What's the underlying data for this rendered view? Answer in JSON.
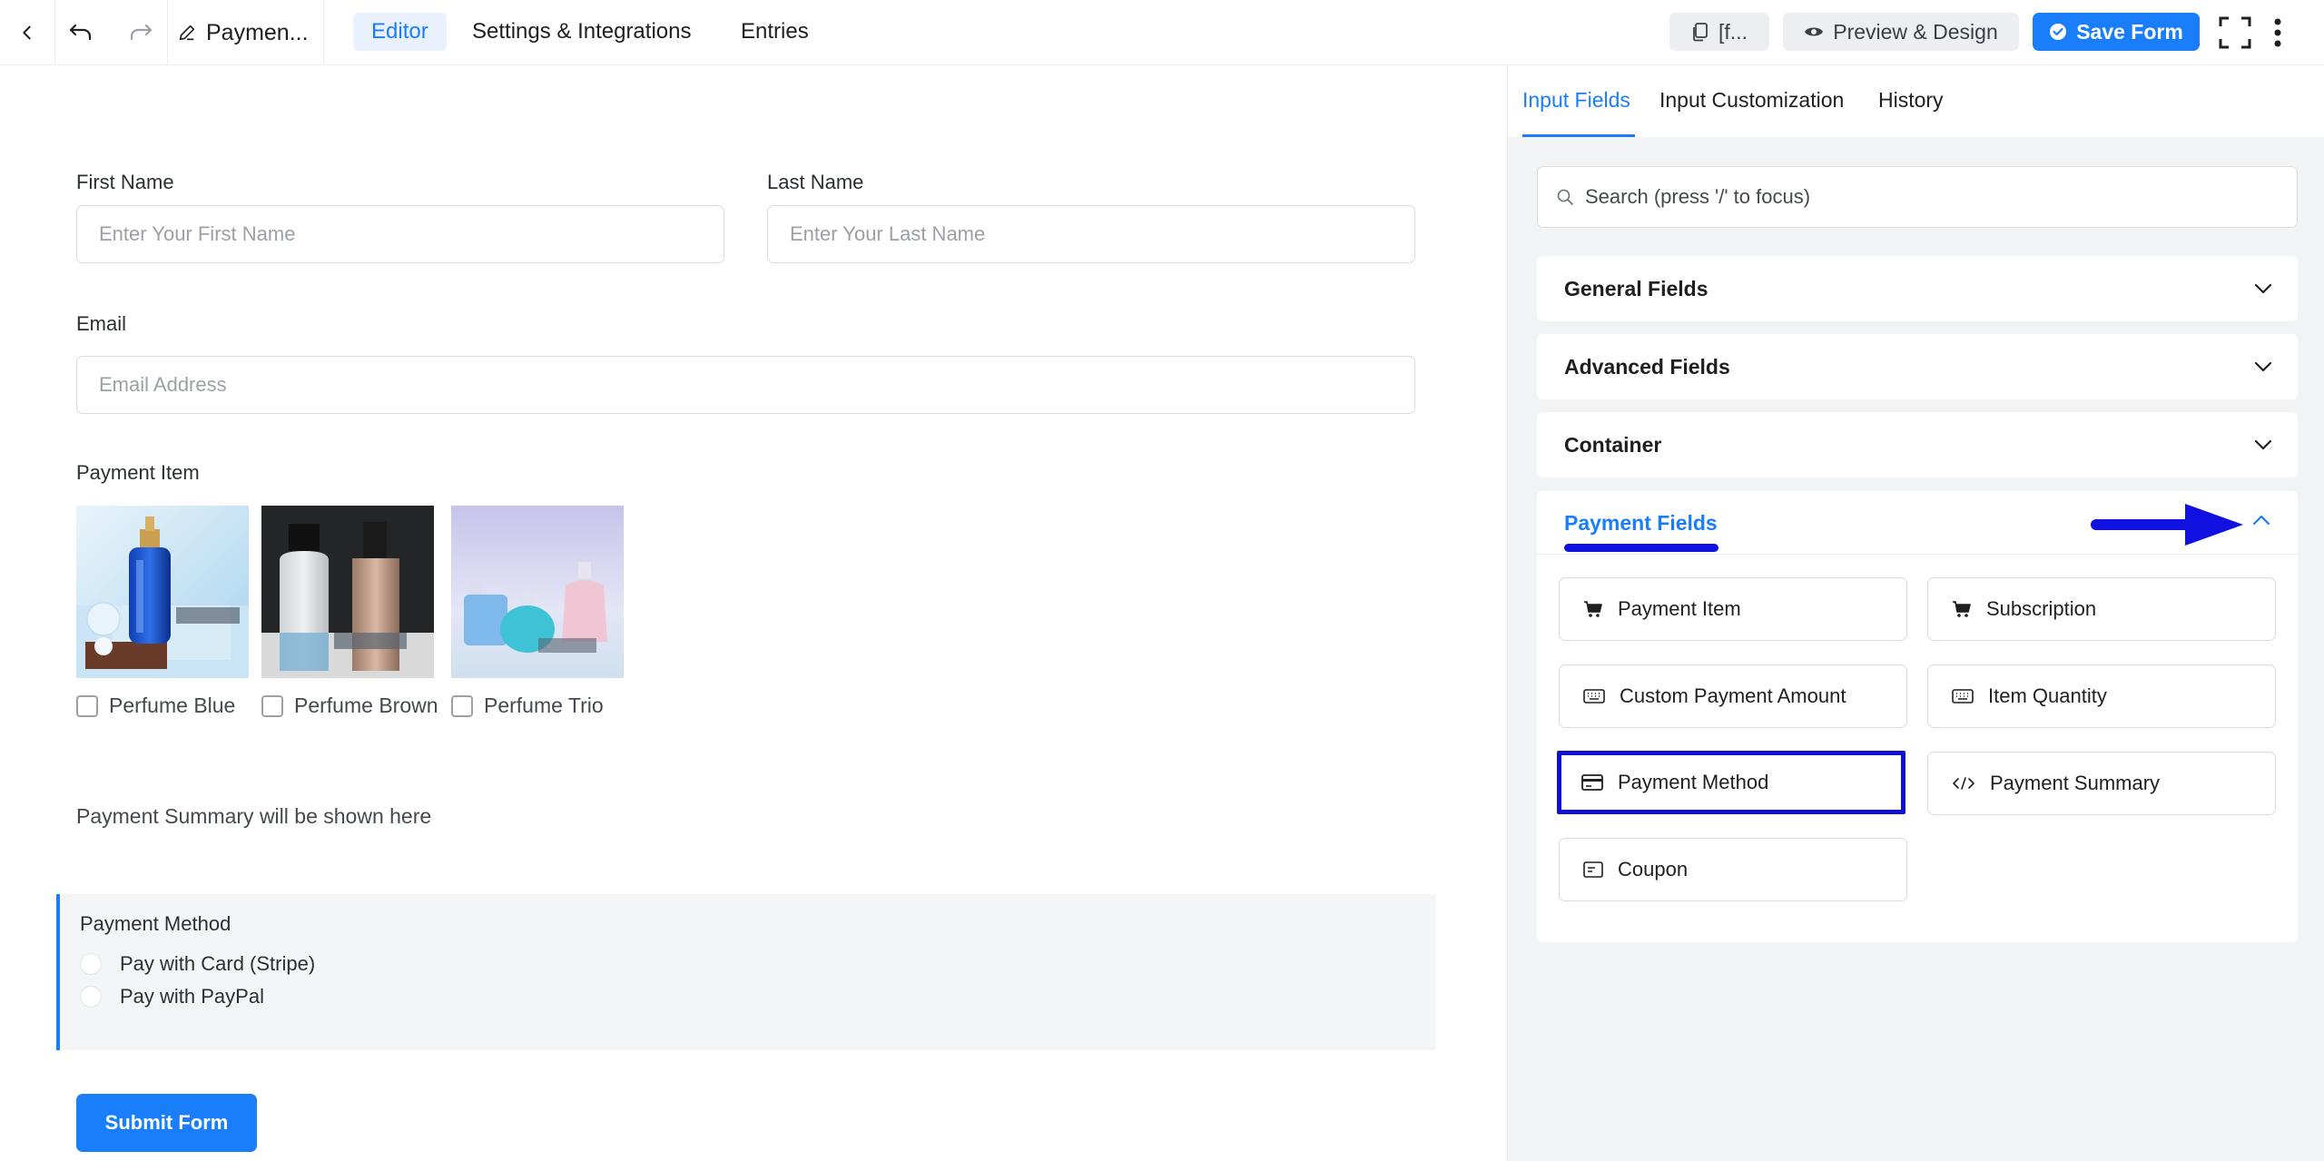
{
  "topbar": {
    "form_title": "Paymen...",
    "tabs": [
      {
        "label": "Editor",
        "active": true
      },
      {
        "label": "Settings & Integrations",
        "active": false
      },
      {
        "label": "Entries",
        "active": false
      }
    ],
    "shortcode_label": "[f...",
    "preview_label": "Preview & Design",
    "save_label": "Save Form"
  },
  "form": {
    "first_name": {
      "label": "First Name",
      "placeholder": "Enter Your First Name"
    },
    "last_name": {
      "label": "Last Name",
      "placeholder": "Enter Your Last Name"
    },
    "email": {
      "label": "Email",
      "placeholder": "Email Address"
    },
    "payment_item": {
      "label": "Payment Item",
      "products": [
        {
          "name": "Perfume Blue"
        },
        {
          "name": "Perfume Brown"
        },
        {
          "name": "Perfume Trio"
        }
      ]
    },
    "summary_text": "Payment Summary will be shown here",
    "payment_method": {
      "label": "Payment Method",
      "options": [
        "Pay with Card (Stripe)",
        "Pay with PayPal"
      ]
    },
    "submit_label": "Submit Form"
  },
  "sidebar": {
    "tabs": [
      {
        "label": "Input Fields",
        "active": true
      },
      {
        "label": "Input Customization",
        "active": false
      },
      {
        "label": "History",
        "active": false
      }
    ],
    "search_placeholder": "Search (press '/' to focus)",
    "sections": [
      {
        "label": "General Fields",
        "expanded": false
      },
      {
        "label": "Advanced Fields",
        "expanded": false
      },
      {
        "label": "Container",
        "expanded": false
      },
      {
        "label": "Payment Fields",
        "expanded": true
      }
    ],
    "payment_fields": [
      {
        "label": "Payment Item",
        "icon": "cart-icon"
      },
      {
        "label": "Subscription",
        "icon": "cart-icon"
      },
      {
        "label": "Custom Payment Amount",
        "icon": "keyboard-icon"
      },
      {
        "label": "Item Quantity",
        "icon": "keyboard-icon"
      },
      {
        "label": "Payment Method",
        "icon": "credit-card-icon",
        "highlighted": true
      },
      {
        "label": "Payment Summary",
        "icon": "code-icon"
      },
      {
        "label": "Coupon",
        "icon": "coupon-icon"
      }
    ]
  },
  "colors": {
    "accent": "#1a7efb",
    "annotation": "#1010e0",
    "sidebar_bg": "#f2f3f5"
  }
}
